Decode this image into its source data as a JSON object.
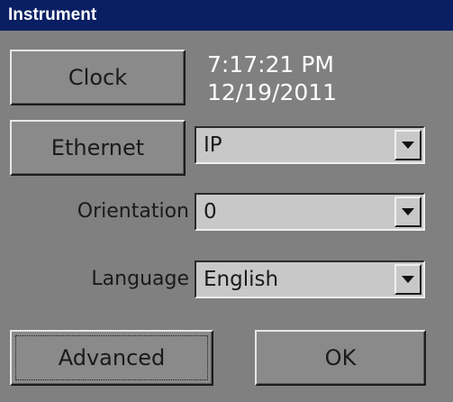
{
  "window": {
    "title": "Instrument"
  },
  "clock": {
    "button_label": "Clock",
    "time": "7:17:21 PM",
    "date": "12/19/2011"
  },
  "ethernet": {
    "button_label": "Ethernet",
    "selected": "IP"
  },
  "orientation": {
    "label": "Orientation",
    "selected": "0"
  },
  "language": {
    "label": "Language",
    "selected": "English"
  },
  "buttons": {
    "advanced": "Advanced",
    "ok": "OK"
  },
  "colors": {
    "titlebar": "#0a1f63",
    "background": "#808080",
    "clock_text": "#ffffff"
  }
}
